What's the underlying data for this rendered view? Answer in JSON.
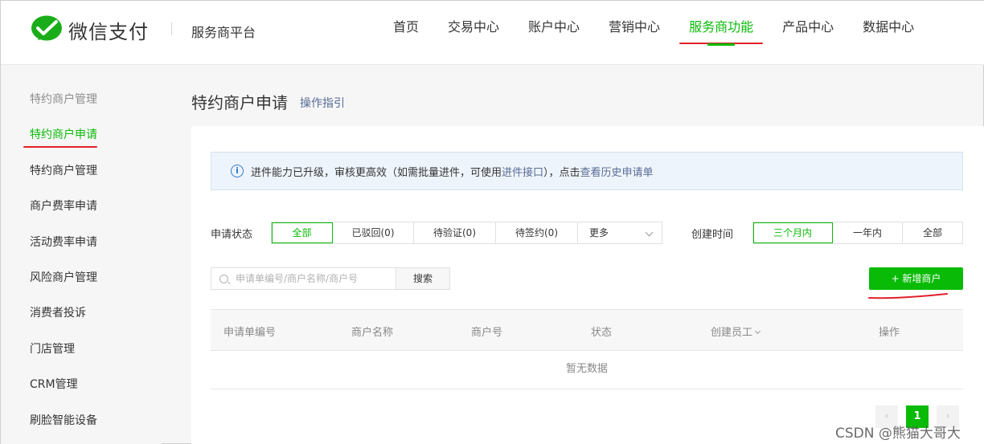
{
  "brand": {
    "name": "微信支付",
    "platform": "服务商平台",
    "green": "#09bb07"
  },
  "nav": {
    "items": [
      {
        "label": "首页",
        "active": false
      },
      {
        "label": "交易中心",
        "active": false
      },
      {
        "label": "账户中心",
        "active": false
      },
      {
        "label": "营销中心",
        "active": false
      },
      {
        "label": "服务商功能",
        "active": true
      },
      {
        "label": "产品中心",
        "active": false
      },
      {
        "label": "数据中心",
        "active": false
      }
    ]
  },
  "sidebar": {
    "group": "特约商户管理",
    "items": [
      {
        "label": "特约商户申请",
        "active": true
      },
      {
        "label": "特约商户管理"
      },
      {
        "label": "商户费率申请"
      },
      {
        "label": "活动费率申请"
      },
      {
        "label": "风险商户管理"
      },
      {
        "label": "消费者投诉"
      },
      {
        "label": "门店管理"
      },
      {
        "label": "CRM管理"
      },
      {
        "label": "刷脸智能设备"
      }
    ]
  },
  "page": {
    "title": "特约商户申请",
    "guide_link": "操作指引"
  },
  "notice": {
    "icon": "info-icon",
    "text1": "进件能力已升级，审核更高效（如需批量进件，可使用 ",
    "link1": "进件接口",
    "text2": "），点击 ",
    "link2": "查看历史申请单"
  },
  "filters": {
    "status_label": "申请状态",
    "status_options": [
      "全部",
      "已驳回(0)",
      "待验证(0)",
      "待签约(0)",
      "更多"
    ],
    "status_selected": "全部",
    "time_label": "创建时间",
    "time_options": [
      "三个月内",
      "一年内",
      "全部"
    ],
    "time_selected": "三个月内"
  },
  "search": {
    "placeholder": "申请单编号/商户名称/商户号",
    "value": "",
    "button": "搜索"
  },
  "add_button": "+ 新增商户",
  "table": {
    "columns": [
      "申请单编号",
      "商户名称",
      "商户号",
      "状态",
      "创建员工",
      "操作"
    ],
    "empty_text": "暂无数据"
  },
  "pagination": {
    "current": "1",
    "prev": "‹",
    "next": "›"
  },
  "watermark": "CSDN @熊猫大哥大"
}
